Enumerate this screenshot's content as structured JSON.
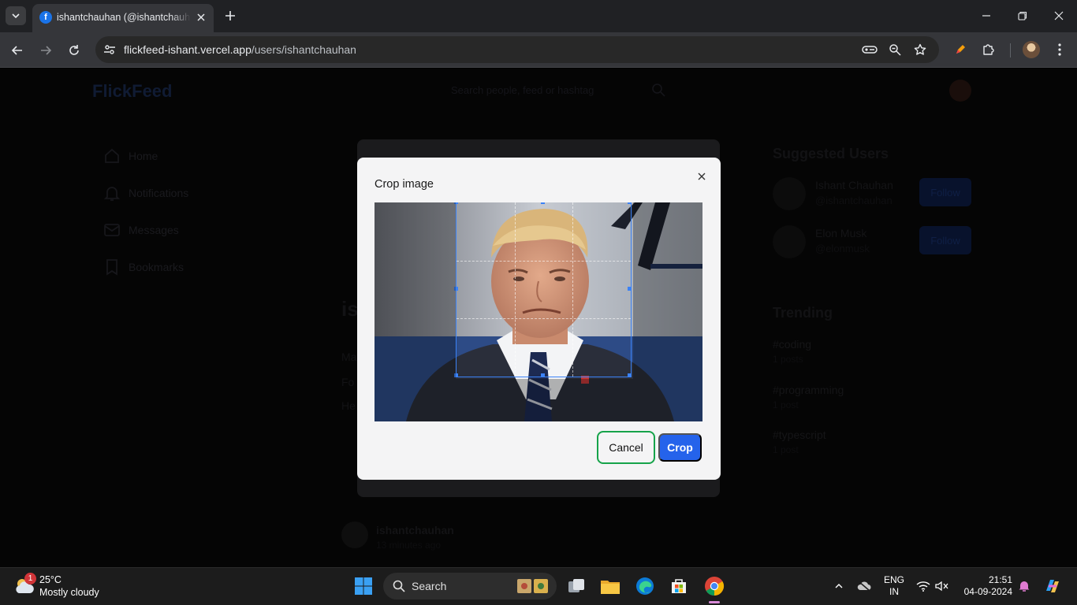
{
  "browser": {
    "tab": {
      "title": "ishantchauhan (@ishantchauhan)",
      "favicon_letter": "f"
    },
    "url_host": "flickfeed-ishant.vercel.app",
    "url_path": "/users/ishantchauhan",
    "icons": {
      "tab_search": "chevron-down-icon",
      "tab_close": "close-icon",
      "new_tab": "plus-icon",
      "minimize": "minimize-icon",
      "restore": "restore-icon",
      "close_window": "close-icon",
      "back": "back-arrow-icon",
      "forward": "forward-arrow-icon",
      "reload": "reload-icon",
      "site_info": "tune-icon",
      "password": "key-icon",
      "zoom": "zoom-icon",
      "bookmark": "star-icon",
      "pen": "pen-icon",
      "extensions": "puzzle-icon",
      "menu": "kebab-menu-icon"
    }
  },
  "app": {
    "brand": "FlickFeed",
    "search_placeholder": "Search people, feed or hashtag",
    "nav": [
      {
        "label": "Home",
        "icon": "home-icon"
      },
      {
        "label": "Notifications",
        "icon": "bell-icon"
      },
      {
        "label": "Messages",
        "icon": "mail-icon"
      },
      {
        "label": "Bookmarks",
        "icon": "bookmark-icon"
      }
    ],
    "suggested_title": "Suggested Users",
    "suggested": [
      {
        "name": "Ishant Chauhan",
        "handle": "@ishantchauhan",
        "button": "Follow"
      },
      {
        "name": "Elon Musk",
        "handle": "@elonmusk",
        "button": "Follow"
      }
    ],
    "trending_title": "Trending",
    "trending": [
      {
        "tag": "#coding",
        "count": "1 posts"
      },
      {
        "tag": "#programming",
        "count": "1 post"
      },
      {
        "tag": "#typescript",
        "count": "1 post"
      }
    ],
    "profile_peek": {
      "initial": "is",
      "lines": [
        "Ma",
        "Fo",
        "He"
      ]
    },
    "post": {
      "author": "ishantchauhan",
      "time": "13 minutes ago"
    }
  },
  "dialog": {
    "title": "Crop image",
    "cancel_label": "Cancel",
    "crop_label": "Crop",
    "close_icon": "close-icon"
  },
  "taskbar": {
    "weather_temp": "25°C",
    "weather_desc": "Mostly cloudy",
    "weather_badge": "1",
    "search_label": "Search",
    "language_line1": "ENG",
    "language_line2": "IN",
    "time": "21:51",
    "date": "04-09-2024"
  },
  "colors": {
    "accent": "#2563eb",
    "cancel_border": "#16a34a",
    "crop_frame": "#3b82f6"
  }
}
